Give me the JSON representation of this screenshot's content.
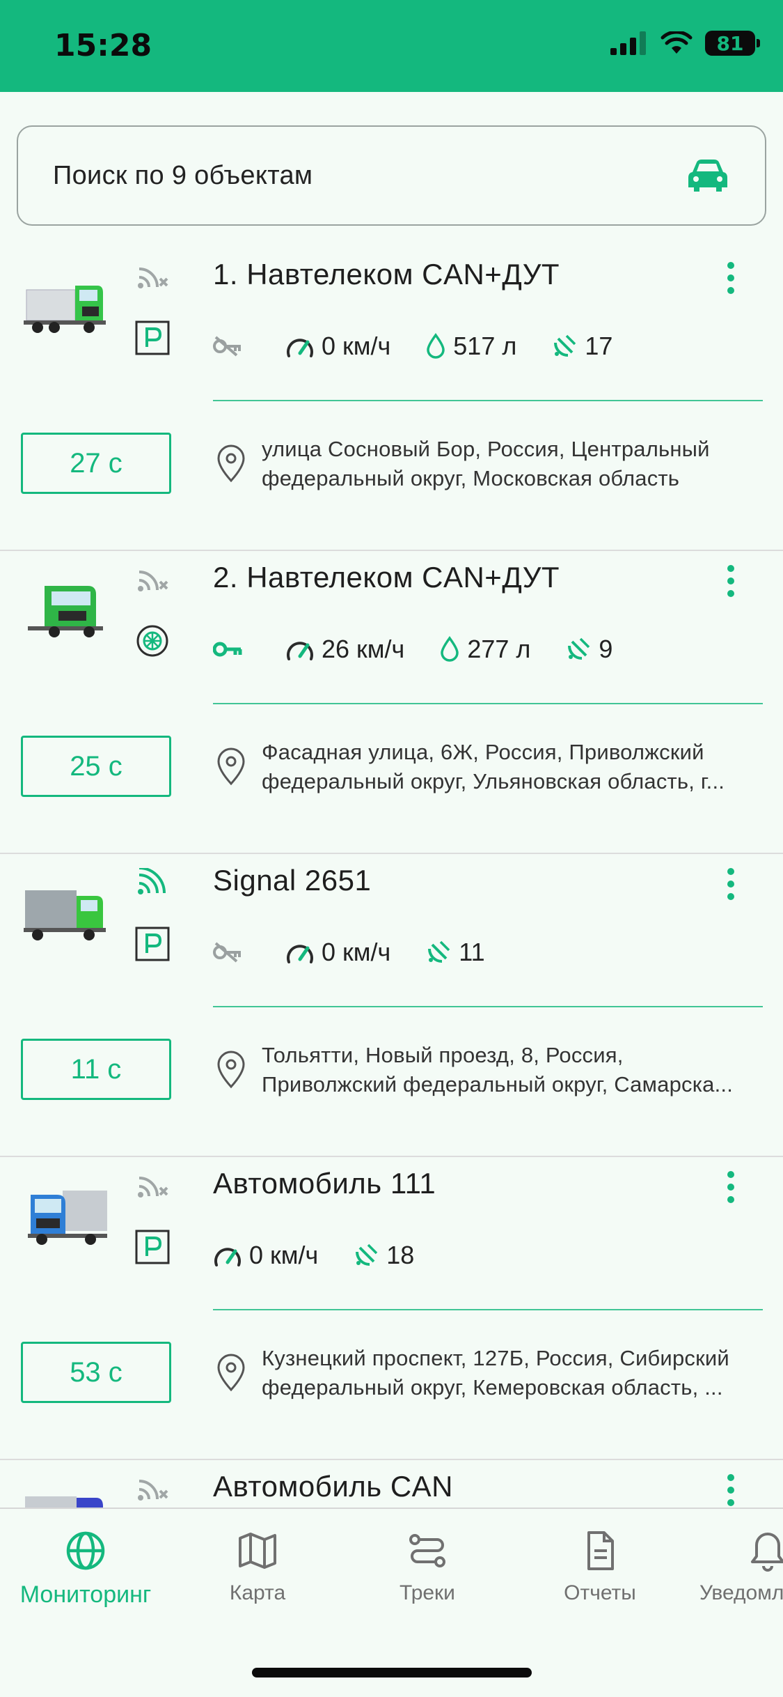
{
  "status": {
    "time": "15:28",
    "battery": "81"
  },
  "search": {
    "text": "Поиск по 9 объектам",
    "icon": "car-icon"
  },
  "colors": {
    "accent": "#14b87e",
    "inactive_icon": "#9aa0a0"
  },
  "objects": [
    {
      "title": "1. Навтелеком CAN+ДУТ",
      "signal": "no-signal",
      "badge": "parking",
      "ignition": "off",
      "speed": "0 км/ч",
      "fuel": "517 л",
      "satellites": "17",
      "time_ago": "27 с",
      "address": [
        "улица Сосновый Бор, Россия, Центральный",
        "федеральный округ, Московская область"
      ]
    },
    {
      "title": "2. Навтелеком CAN+ДУТ",
      "signal": "no-signal",
      "badge": "wheel",
      "ignition": "on",
      "speed": "26 км/ч",
      "fuel": "277 л",
      "satellites": "9",
      "time_ago": "25 с",
      "address": [
        "Фасадная улица, 6Ж, Россия, Приволжский",
        "федеральный округ, Ульяновская область, г..."
      ]
    },
    {
      "title": "Signal 2651",
      "signal": "online",
      "badge": "parking",
      "ignition": "off",
      "speed": "0 км/ч",
      "satellites": "11",
      "time_ago": "11 с",
      "address": [
        "Тольятти, Новый проезд, 8, Россия,",
        "Приволжский федеральный округ, Самарска..."
      ]
    },
    {
      "title": "Автомобиль 111",
      "signal": "no-signal",
      "badge": "parking",
      "speed": "0 км/ч",
      "satellites": "18",
      "time_ago": "53 с",
      "address": [
        "Кузнецкий проспект, 127Б, Россия, Сибирский",
        "федеральный округ, Кемеровская область, ..."
      ]
    },
    {
      "title": "Автомобиль CAN",
      "signal": "no-signal"
    }
  ],
  "tabs": [
    {
      "label": "Мониторинг",
      "icon": "globe-icon",
      "active": true
    },
    {
      "label": "Карта",
      "icon": "map-icon"
    },
    {
      "label": "Треки",
      "icon": "route-icon"
    },
    {
      "label": "Отчеты",
      "icon": "document-icon"
    },
    {
      "label": "Уведомл",
      "icon": "bell-icon"
    }
  ]
}
